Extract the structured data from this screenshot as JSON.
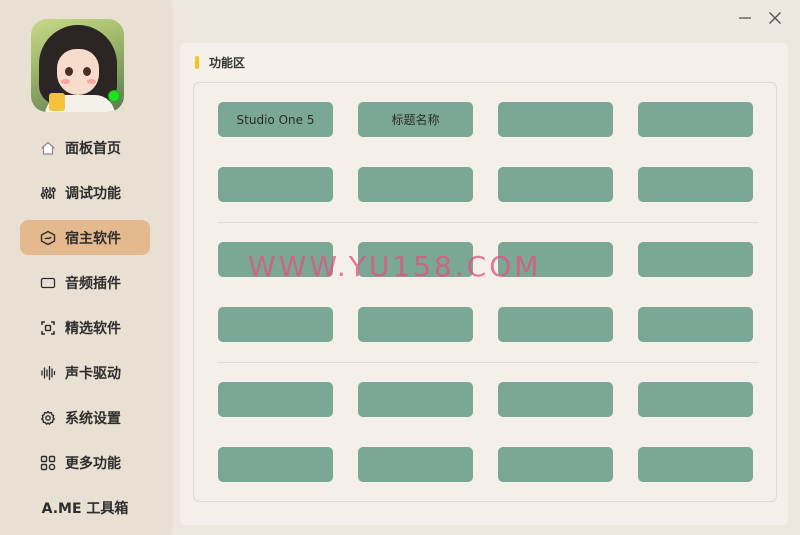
{
  "window": {
    "minimize_icon": "minimize-icon",
    "close_icon": "close-icon"
  },
  "sidebar": {
    "items": [
      {
        "label": "面板首页",
        "icon": "home-icon"
      },
      {
        "label": "调试功能",
        "icon": "sliders-icon"
      },
      {
        "label": "宿主软件",
        "icon": "host-icon",
        "active": true
      },
      {
        "label": "音频插件",
        "icon": "plugin-icon"
      },
      {
        "label": "精选软件",
        "icon": "featured-icon"
      },
      {
        "label": "声卡驱动",
        "icon": "waveform-icon"
      },
      {
        "label": "系统设置",
        "icon": "gear-icon"
      },
      {
        "label": "更多功能",
        "icon": "grid-icon"
      }
    ],
    "footer": "A.ME 工具箱"
  },
  "panel": {
    "title": "功能区",
    "rows": [
      [
        "Studio One 5",
        "标题名称",
        "",
        ""
      ],
      [
        "",
        "",
        "",
        ""
      ],
      [
        "",
        "",
        "",
        ""
      ],
      [
        "",
        "",
        "",
        ""
      ],
      [
        "",
        "",
        "",
        ""
      ],
      [
        "",
        "",
        "",
        ""
      ]
    ]
  },
  "watermark": "WWW.YU158.COM",
  "colors": {
    "sidebar_bg": "#e9e0d4",
    "active_item": "#e5b98e",
    "tile": "#7aa796",
    "accent_bar": "#f3c623",
    "watermark": "#e45080"
  }
}
